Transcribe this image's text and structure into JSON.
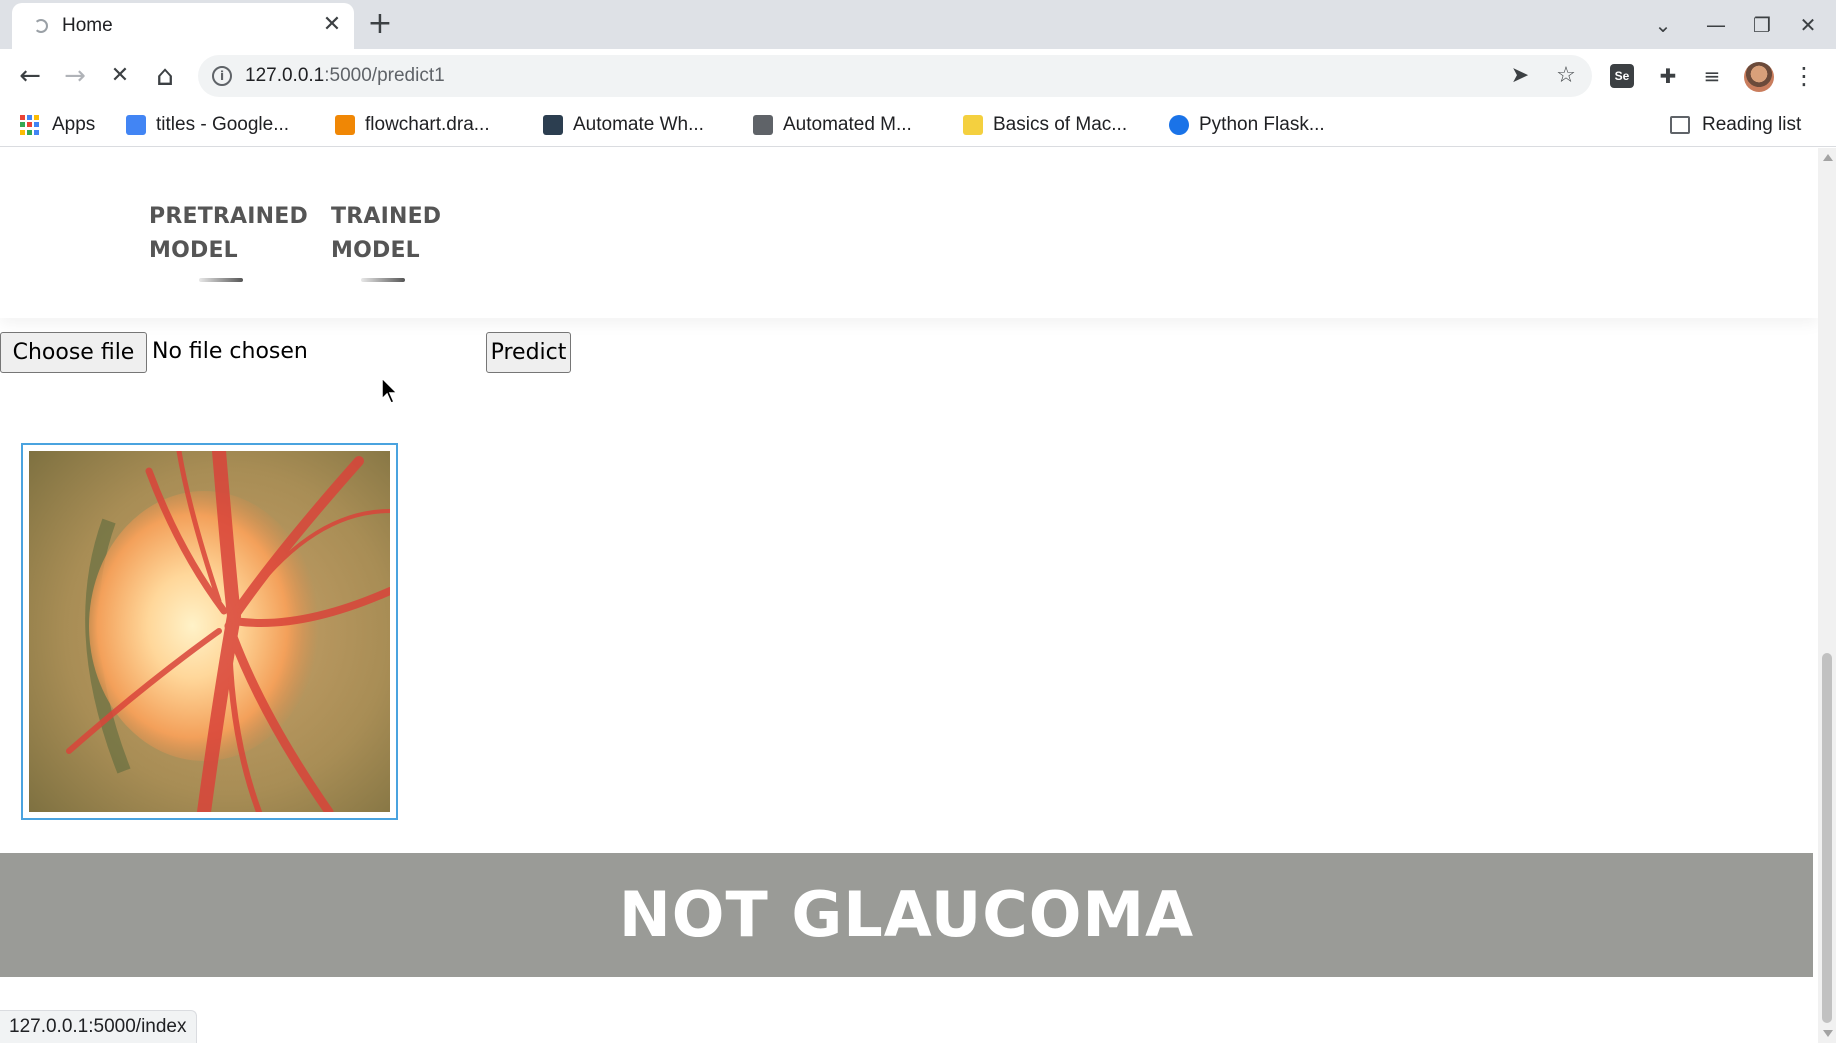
{
  "browser": {
    "tab_title": "Home",
    "tab_close": "✕",
    "new_tab": "+",
    "url_host": "127.0.0.1",
    "url_rest": ":5000/predict1",
    "window_controls": {
      "tab_search": "⌄",
      "minimize": "—",
      "restore": "❐",
      "close": "✕"
    },
    "nav": {
      "back": "←",
      "forward": "→",
      "stop": "✕",
      "home": "⌂"
    },
    "omnibox_icons": {
      "send": "➤",
      "bookmark": "☆"
    },
    "extensions": {
      "selenium": "Se",
      "puzzle": "✚",
      "media": "≡",
      "menu": "⋮"
    }
  },
  "bookmarks": {
    "apps_label": "Apps",
    "items": [
      {
        "label": "titles - Google...",
        "icon": "google-docs-icon",
        "color": "#4285f4"
      },
      {
        "label": "flowchart.dra...",
        "icon": "drawio-icon",
        "color": "#f08705"
      },
      {
        "label": "Automate Wh...",
        "icon": "tds-icon",
        "color": "#2c3e50"
      },
      {
        "label": "Automated M...",
        "icon": "person-icon",
        "color": "#5f6368"
      },
      {
        "label": "Basics of Mac...",
        "icon": "coursera-icon",
        "color": "#f4d03f"
      },
      {
        "label": "Python Flask...",
        "icon": "r-icon",
        "color": "#1a73e8"
      }
    ],
    "reading_list": "Reading list"
  },
  "page": {
    "nav": {
      "pretrained_line1": "PRETRAINED",
      "pretrained_line2": "MODEL",
      "trained_line1": "TRAINED",
      "trained_line2": "MODEL"
    },
    "choose_file_label": "Choose file",
    "file_status": "No file chosen",
    "predict_label": "Predict",
    "result": "NOT GLAUCOMA"
  },
  "status_bar": "127.0.0.1:5000/index",
  "colors": {
    "banner": "#9a9b97",
    "image_border": "#4aa3df",
    "nav_text": "#555555"
  }
}
